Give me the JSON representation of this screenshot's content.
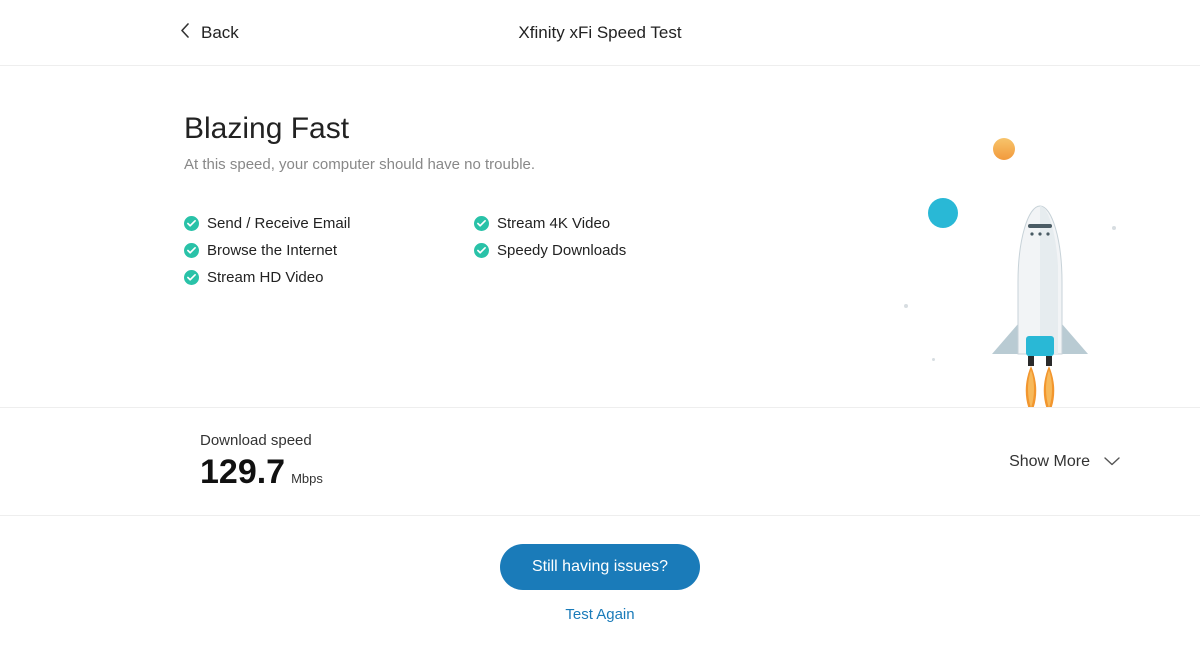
{
  "header": {
    "back_label": "Back",
    "title": "Xfinity xFi Speed Test"
  },
  "result": {
    "heading": "Blazing Fast",
    "subheading": "At this speed, your computer should have no trouble.",
    "capabilities_col1": [
      "Send / Receive Email",
      "Browse the Internet",
      "Stream HD Video"
    ],
    "capabilities_col2": [
      "Stream 4K Video",
      "Speedy Downloads"
    ]
  },
  "download": {
    "label": "Download speed",
    "value": "129.7",
    "unit": "Mbps",
    "show_more": "Show More"
  },
  "actions": {
    "primary": "Still having issues?",
    "secondary": "Test Again"
  },
  "colors": {
    "accent_teal": "#29c2a8",
    "primary_blue": "#1a7bb9"
  }
}
